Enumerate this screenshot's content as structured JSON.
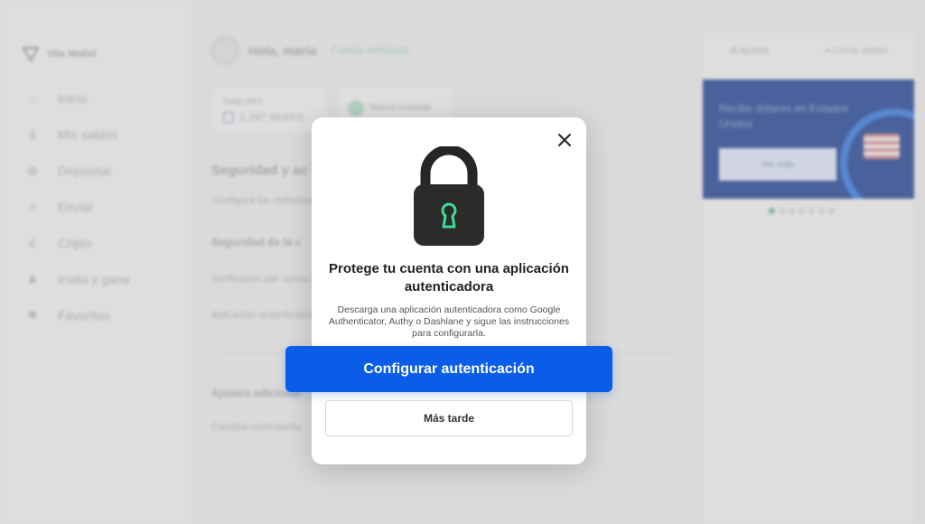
{
  "app": {
    "brand": "Vita Wallet",
    "greeting": "Hola, maria",
    "verified": "Cuenta verificada"
  },
  "sidebar": {
    "items": [
      {
        "label": "Inicio",
        "icon": "home-icon",
        "glyph": "⌂"
      },
      {
        "label": "Mis saldos",
        "icon": "dollar-icon",
        "glyph": "$"
      },
      {
        "label": "Depositar",
        "icon": "piggy-bank-icon",
        "glyph": "◍"
      },
      {
        "label": "Enviar",
        "icon": "send-icon",
        "glyph": "➢"
      },
      {
        "label": "Cripto",
        "icon": "crypto-icon",
        "glyph": "€"
      },
      {
        "label": "Invita y gana",
        "icon": "users-icon",
        "glyph": "♟"
      },
      {
        "label": "Favoritos",
        "icon": "star-icon",
        "glyph": "✱"
      }
    ]
  },
  "balance_card": {
    "label": "Saldo ARS",
    "value": "2,297.86ARS"
  },
  "new_card": {
    "label": "Nueva moneda"
  },
  "content": {
    "section_title": "Seguridad y ac",
    "section_sub": "Configura tus métodos",
    "security_title": "Seguridad de la c",
    "row_1": "Verificación por correo",
    "row_2": "Aplicación autenticador",
    "extra_title": "Ajustes adicional",
    "row_3": "Cambiar contraseña"
  },
  "topbar": {
    "settings": "Ajustes",
    "logout": "Cerrar sesión"
  },
  "promo": {
    "text": "Recibe dólares en Estados Unidos",
    "button": "Ver más"
  },
  "carousel": {
    "total": 7,
    "active": 0
  },
  "modal": {
    "title": "Protege tu cuenta con una aplicación autenticadora",
    "description": "Descarga una aplicación autenticadora como Google Authenticator, Authy o Dashlane y sigue las instrucciones para configurarla.",
    "primary_button": "Configurar autenticación",
    "secondary_button": "Más tarde",
    "close_icon": "close-icon",
    "lock_icon": "padlock-icon"
  },
  "colors": {
    "primary": "#0a5de8",
    "accent_green": "#3ddc97",
    "lock_body": "#2b2b2b"
  }
}
